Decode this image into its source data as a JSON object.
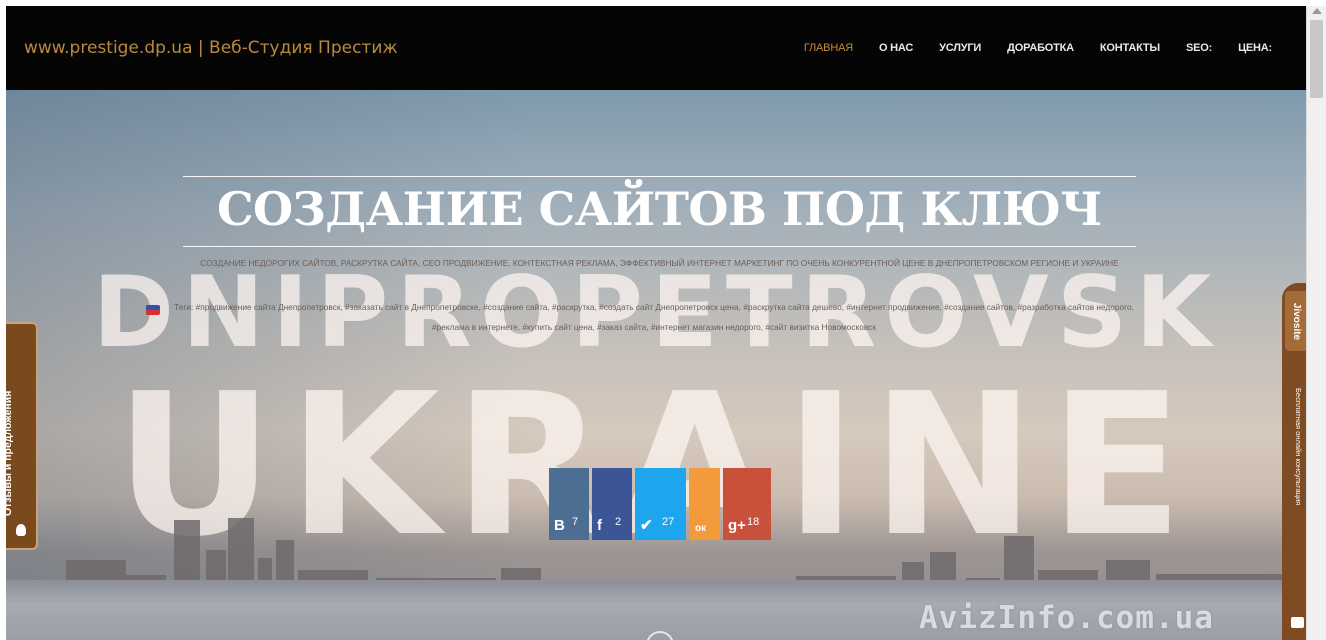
{
  "header": {
    "site_title": "www.prestige.dp.ua | Веб-Студия Престиж",
    "menu": [
      {
        "label": "ГЛАВНАЯ",
        "active": true
      },
      {
        "label": "О НАС",
        "active": false
      },
      {
        "label": "УСЛУГИ",
        "active": false
      },
      {
        "label": "ДОРАБОТКА",
        "active": false
      },
      {
        "label": "КОНТАКТЫ",
        "active": false
      },
      {
        "label": "SEO:",
        "active": false
      },
      {
        "label": "ЦЕНА:",
        "active": false
      }
    ]
  },
  "hero": {
    "headline": "СОЗДАНИЕ САЙТОВ ПОД КЛЮЧ",
    "subline": "СОЗДАНИЕ НЕДОРОГИХ САЙТОВ, РАСКРУТКА САЙТА, СЕО ПРОДВИЖЕНИЕ, КОНТЕКСТНАЯ РЕКЛАМА, ЭФФЕКТИВНЫЙ ИНТЕРНЕТ МАРКЕТИНГ ПО ОЧЕНЬ КОНКУРЕНТНОЙ ЦЕНЕ В ДНЕПРОПЕТРОВСКОМ РЕГИОНЕ И УКРАИНЕ",
    "tags": "Теги: #продвижение сайта Днепропетровск, #заказать сайт в Днепропетровске, #создание сайта, #раскрутка, #создать сайт Днепропетровск цена, #раскрутка сайта дешево, #интернет продвижение, #создание сайтов, #разработка сайтов недорого, #реклама в интернете, #купить сайт цена, #заказ сайта, #интернет магазин недорого, #сайт визитка Новомосковск",
    "watermark_city": "DNIPROPETROVSK",
    "watermark_country": "UKRAINE"
  },
  "share": [
    {
      "network": "vkontakte",
      "symbol": "В",
      "count": "7",
      "color": "#4c6e93"
    },
    {
      "network": "facebook",
      "symbol": "f",
      "count": "2",
      "color": "#3b5597"
    },
    {
      "network": "twitter",
      "symbol": "✔",
      "count": "27",
      "color": "#1da6ee"
    },
    {
      "network": "odnoklassniki",
      "symbol": "ок",
      "count": "",
      "color": "#f39a3c"
    },
    {
      "network": "google-plus",
      "symbol": "g+",
      "count": "18",
      "color": "#c9503a"
    }
  ],
  "side_tabs": {
    "feedback_label": "Отзывы и предложения",
    "consult_brand": "Jivosite",
    "consult_label": "Бесплатная онлайн консультация"
  },
  "watermark_source": "AvizInfo.com.ua",
  "colors": {
    "nav_bg": "#050505",
    "accent_gold": "#b98a3d",
    "tab_brown": "#7a4a1f"
  }
}
